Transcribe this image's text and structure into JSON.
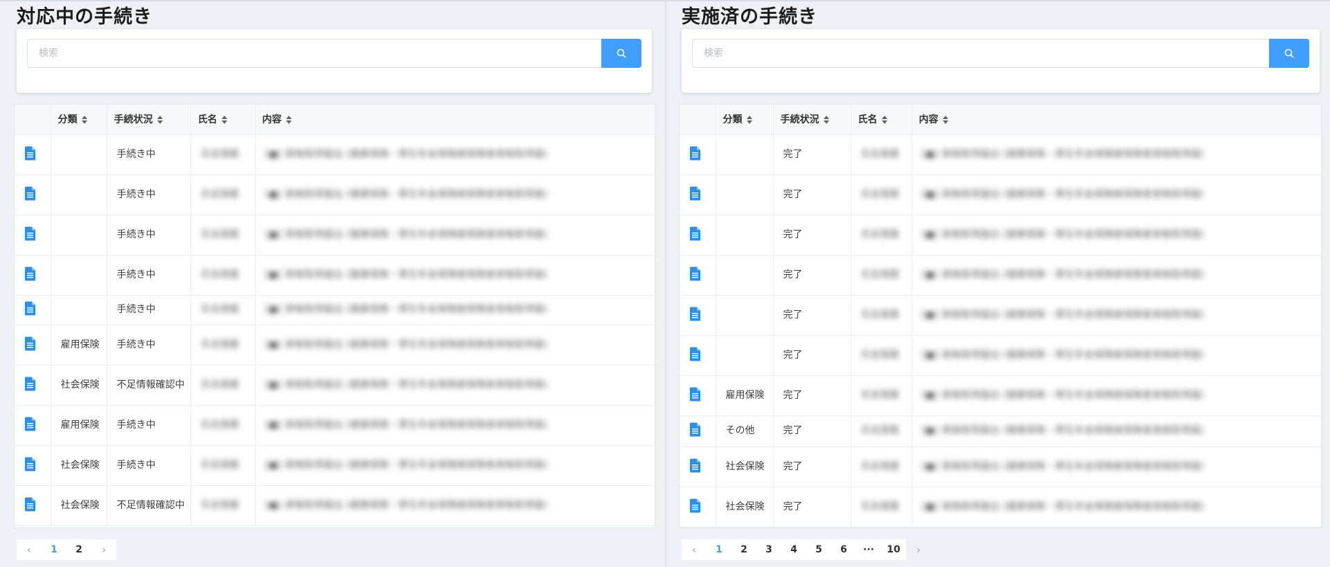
{
  "search_placeholder": "検索",
  "columns": {
    "category": "分類",
    "status": "手続状況",
    "name": "氏名",
    "content": "内容"
  },
  "left": {
    "title": "対応中の手続き",
    "rows": [
      {
        "category": "",
        "status": "手続き中",
        "name": "氏名隠匿",
        "content": "[■] 資格取得届出 (健康保険・厚生年金保険被保険者資格取得届)"
      },
      {
        "category": "",
        "status": "手続き中",
        "name": "氏名隠匿",
        "content": "[■] 資格取得届出 (健康保険・厚生年金保険被保険者資格取得届)"
      },
      {
        "category": "",
        "status": "手続き中",
        "name": "氏名隠匿",
        "content": "[■] 資格取得届出 (健康保険・厚生年金保険被保険者資格取得届)"
      },
      {
        "category": "",
        "status": "手続き中",
        "name": "氏名隠匿",
        "content": "[■] 資格取得届出 (健康保険・厚生年金保険被保険者資格取得届)"
      },
      {
        "category": "",
        "status": "手続き中",
        "name": "氏名隠匿",
        "content": "[■] 資格取得届出 (健康保険・厚生年金保険被保険者資格取得届)"
      },
      {
        "category": "雇用保険",
        "status": "手続き中",
        "name": "氏名隠匿",
        "content": "[■] 資格取得届出 (健康保険・厚生年金保険被保険者資格取得届)"
      },
      {
        "category": "社会保険",
        "status": "不足情報確認中",
        "name": "氏名隠匿",
        "content": "[■] 資格取得届出 (健康保険・厚生年金保険被保険者資格取得届)"
      },
      {
        "category": "雇用保険",
        "status": "手続き中",
        "name": "氏名隠匿",
        "content": "[■] 資格取得届出 (健康保険・厚生年金保険被保険者資格取得届)"
      },
      {
        "category": "社会保険",
        "status": "手続き中",
        "name": "氏名隠匿",
        "content": "[■] 資格取得届出 (健康保険・厚生年金保険被保険者資格取得届)"
      },
      {
        "category": "社会保険",
        "status": "不足情報確認中",
        "name": "氏名隠匿",
        "content": "[■] 資格取得届出 (健康保険・厚生年金保険被保険者資格取得届)"
      }
    ],
    "pager": {
      "prev": "‹",
      "pages": [
        "1",
        "2"
      ],
      "active": "1",
      "next": "›"
    }
  },
  "right": {
    "title": "実施済の手続き",
    "rows": [
      {
        "category": "",
        "status": "完了",
        "name": "氏名隠匿",
        "content": "[■] 資格取得届出 (健康保険・厚生年金保険被保険者資格取得届)"
      },
      {
        "category": "",
        "status": "完了",
        "name": "氏名隠匿",
        "content": "[■] 資格取得届出 (健康保険・厚生年金保険被保険者資格取得届)"
      },
      {
        "category": "",
        "status": "完了",
        "name": "氏名隠匿",
        "content": "[■] 資格取得届出 (健康保険・厚生年金保険被保険者資格取得届)"
      },
      {
        "category": "",
        "status": "完了",
        "name": "氏名隠匿",
        "content": "[■] 資格取得届出 (健康保険・厚生年金保険被保険者資格取得届)"
      },
      {
        "category": "",
        "status": "完了",
        "name": "氏名隠匿",
        "content": "[■] 資格取得届出 (健康保険・厚生年金保険被保険者資格取得届)"
      },
      {
        "category": "",
        "status": "完了",
        "name": "氏名隠匿",
        "content": "[■] 資格取得届出 (健康保険・厚生年金保険被保険者資格取得届)"
      },
      {
        "category": "雇用保険",
        "status": "完了",
        "name": "氏名隠匿",
        "content": "[■] 資格取得届出 (健康保険・厚生年金保険被保険者資格取得届)"
      },
      {
        "category": "その他",
        "status": "完了",
        "name": "氏名隠匿",
        "content": "[■] 資格取得届出 (健康保険・厚生年金保険被保険者資格取得届)"
      },
      {
        "category": "社会保険",
        "status": "完了",
        "name": "氏名隠匿",
        "content": "[■] 資格取得届出 (健康保険・厚生年金保険被保険者資格取得届)"
      },
      {
        "category": "社会保険",
        "status": "完了",
        "name": "氏名隠匿",
        "content": "[■] 資格取得届出 (健康保険・厚生年金保険被保険者資格取得届)"
      }
    ],
    "pager": {
      "prev": "‹",
      "pages": [
        "1",
        "2",
        "3",
        "4",
        "5",
        "6",
        "···",
        "10"
      ],
      "active": "1",
      "next": "›"
    }
  },
  "colors": {
    "accent": "#409eff",
    "icon": "#2f8fe0"
  }
}
